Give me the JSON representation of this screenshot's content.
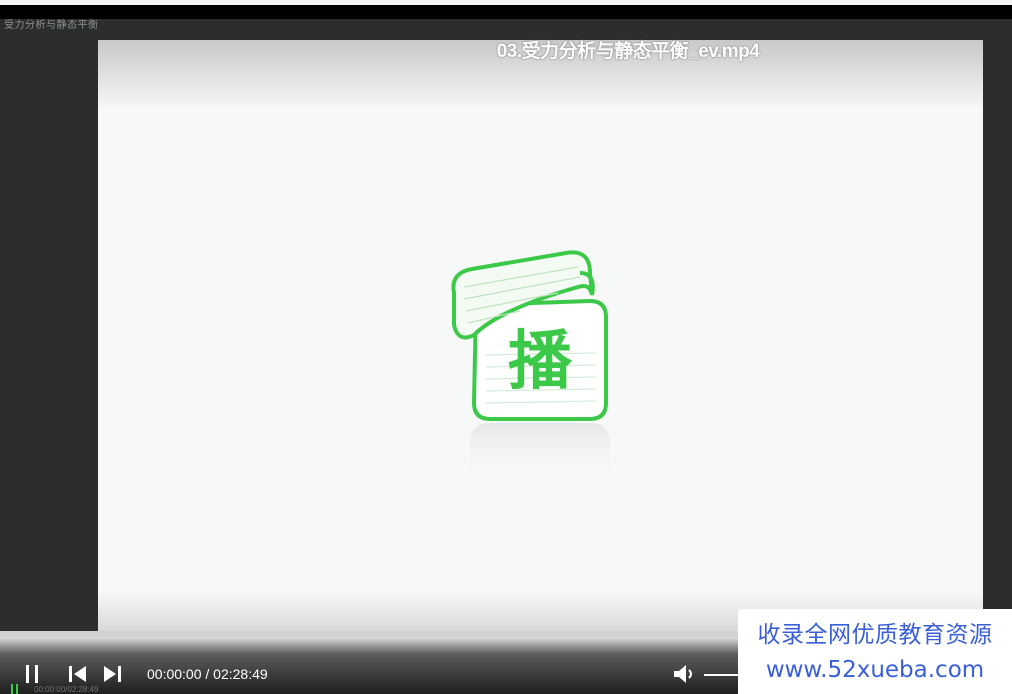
{
  "window": {
    "title": "受力分析与静态平衡"
  },
  "video": {
    "filename": "03.受力分析与静态平衡_ev.mp4",
    "logo_char": "播"
  },
  "controls": {
    "time_display": "00:00:00 / 02:28:49",
    "mini_time": "00:00:00/02:28:49",
    "progress_fraction": 0
  },
  "watermark": {
    "line1": "收录全网优质教育资源",
    "line2": "www.52xueba.com"
  },
  "icons": {
    "pause": "pause-icon",
    "prev": "skip-back-icon",
    "next": "skip-forward-icon",
    "volume": "volume-icon",
    "logo": "player-logo-icon"
  },
  "colors": {
    "accent_green": "#3cc94a",
    "watermark_blue": "#3a5fd7"
  }
}
